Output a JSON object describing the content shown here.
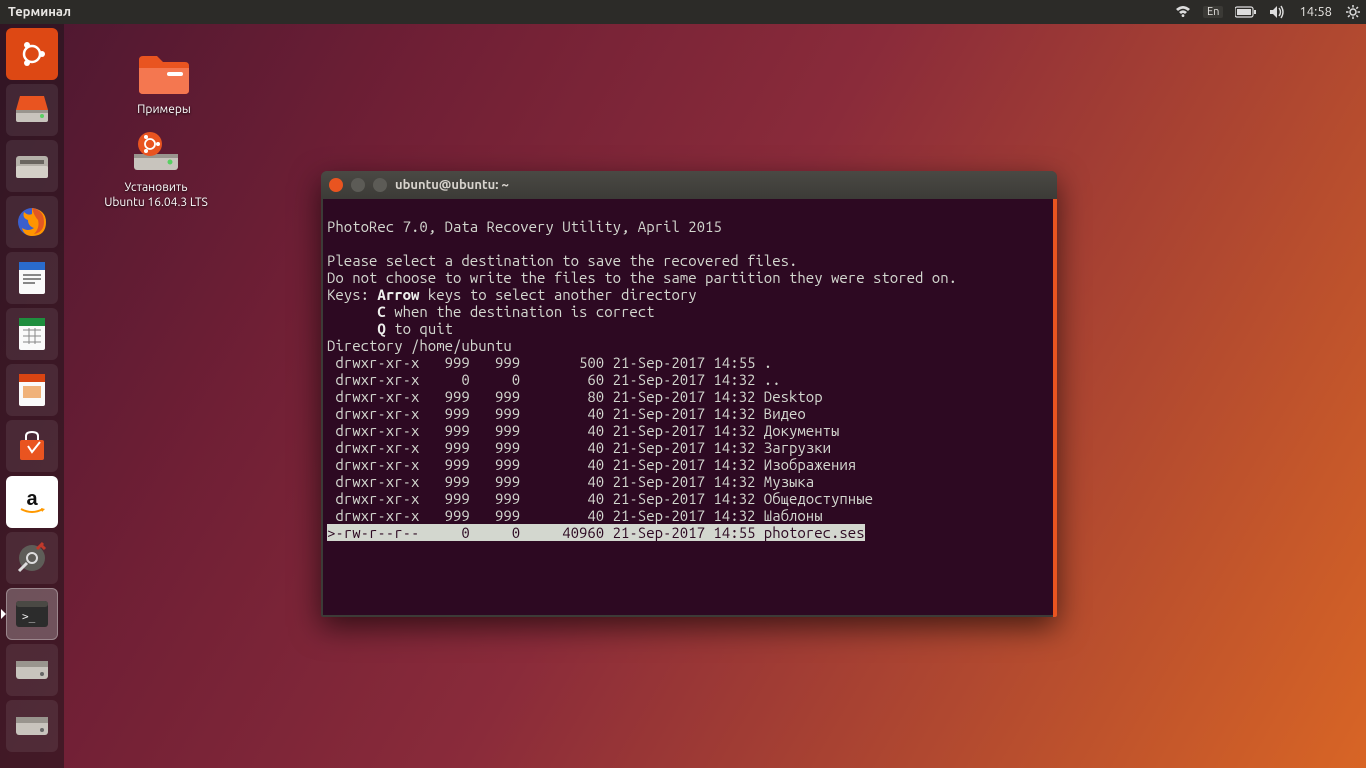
{
  "panel": {
    "app_title": "Терминал",
    "lang": "En",
    "clock": "14:58"
  },
  "desktop": {
    "examples_label": "Примеры",
    "install_label": "Установить\nUbuntu 16.04.3 LTS"
  },
  "launcher_items": [
    "dash",
    "disk1",
    "files",
    "firefox",
    "writer",
    "calc",
    "impress",
    "software",
    "amazon",
    "settings",
    "terminal",
    "disk2",
    "disk3"
  ],
  "terminal": {
    "title": "ubuntu@ubuntu: ~",
    "header": "PhotoRec 7.0, Data Recovery Utility, April 2015",
    "msg1": "Please select a destination to save the recovered files.",
    "msg2": "Do not choose to write the files to the same partition they were stored on.",
    "keys_label": "Keys:",
    "arrow_label": "Arrow",
    "arrow_desc": " keys to select another directory",
    "c_key": "C",
    "c_desc": " when the destination is correct",
    "q_key": "Q",
    "q_desc": " to quit",
    "dir_line": "Directory /home/ubuntu",
    "rows": [
      " drwxr-xr-x   999   999       500 21-Sep-2017 14:55 .",
      " drwxr-xr-x     0     0        60 21-Sep-2017 14:32 ..",
      " drwxr-xr-x   999   999        80 21-Sep-2017 14:32 Desktop",
      " drwxr-xr-x   999   999        40 21-Sep-2017 14:32 Видео",
      " drwxr-xr-x   999   999        40 21-Sep-2017 14:32 Документы",
      " drwxr-xr-x   999   999        40 21-Sep-2017 14:32 Загрузки",
      " drwxr-xr-x   999   999        40 21-Sep-2017 14:32 Изображения",
      " drwxr-xr-x   999   999        40 21-Sep-2017 14:32 Музыка",
      " drwxr-xr-x   999   999        40 21-Sep-2017 14:32 Общедоступные",
      " drwxr-xr-x   999   999        40 21-Sep-2017 14:32 Шаблоны"
    ],
    "selected_row": ">-rw-r--r--     0     0     40960 21-Sep-2017 14:55 photorec.ses"
  }
}
